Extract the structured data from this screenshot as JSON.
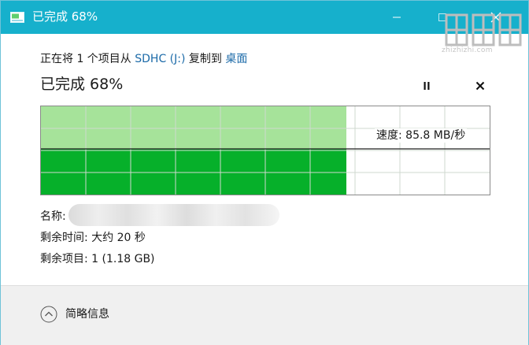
{
  "window": {
    "title": "已完成 68%",
    "minimize_icon": "minimize-icon",
    "maximize_icon": "maximize-icon",
    "close_icon": "close-icon"
  },
  "copy": {
    "prefix": "正在将 1 个项目从 ",
    "source": "SDHC (J:)",
    "middle": " 复制到 ",
    "destination": "桌面"
  },
  "progress": {
    "title": "已完成 68%",
    "percent": 68,
    "pause_icon": "pause-icon",
    "cancel_icon": "cancel-icon"
  },
  "graph": {
    "speed_label": "速度: 85.8 MB/秒",
    "colors": {
      "filled": "#06b02a",
      "history": "#a6e39a",
      "grid": "#cfd8cf",
      "speed_line": "#222222"
    }
  },
  "details": {
    "name_label": "名称:",
    "time_remaining": "剩余时间: 大约 20 秒",
    "items_remaining": "剩余项目: 1 (1.18 GB)"
  },
  "footer": {
    "toggle_label": "简略信息",
    "toggle_icon": "chevron-up-circle-icon"
  },
  "watermark": {
    "site": "zhizhizhi.com"
  }
}
